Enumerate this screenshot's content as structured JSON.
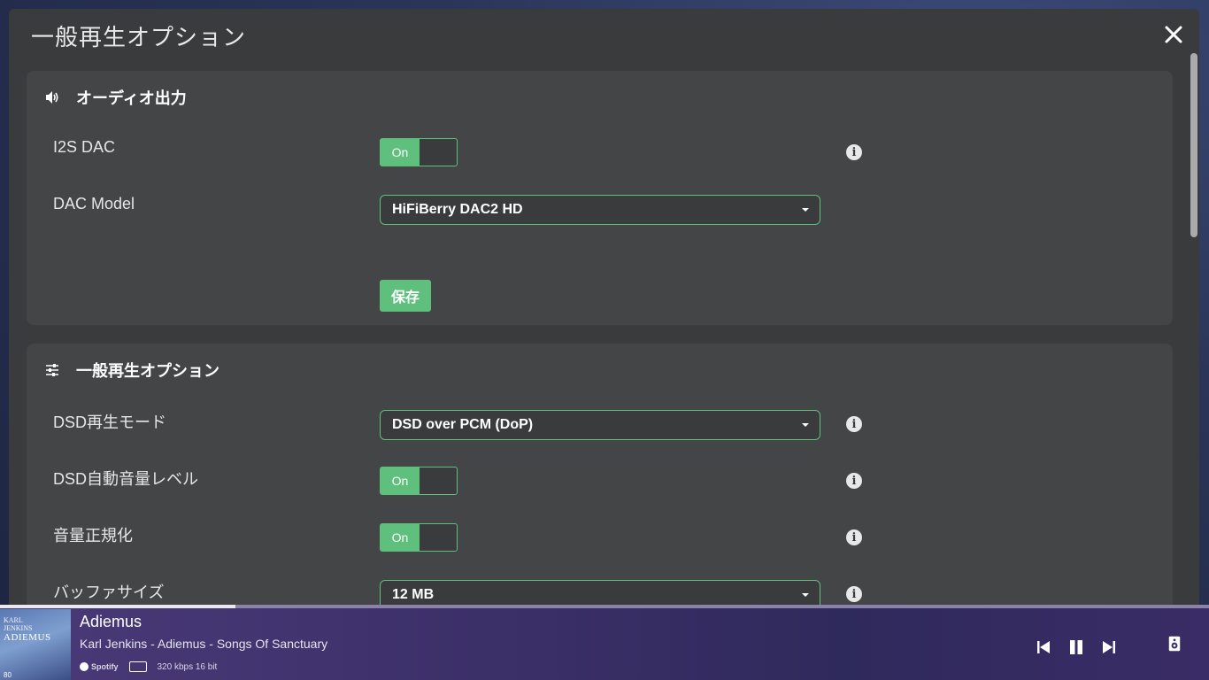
{
  "modal": {
    "title": "一般再生オプション"
  },
  "audio_output": {
    "heading": "オーディオ出力",
    "i2s_dac_label": "I2S DAC",
    "i2s_dac_toggle": "On",
    "dac_model_label": "DAC Model",
    "dac_model_value": "HiFiBerry DAC2 HD",
    "save_label": "保存"
  },
  "general_playback": {
    "heading": "一般再生オプション",
    "dsd_mode_label": "DSD再生モード",
    "dsd_mode_value": "DSD over PCM (DoP)",
    "dsd_auto_volume_label": "DSD自動音量レベル",
    "dsd_auto_volume_toggle": "On",
    "volume_normalize_label": "音量正規化",
    "volume_normalize_toggle": "On",
    "buffer_size_label": "バッファサイズ",
    "buffer_size_value": "12 MB"
  },
  "player": {
    "progress_fraction": 0.195,
    "cover_line1": "KARL\nJENKINS",
    "cover_line2": "ADIEMUS",
    "cover_badge": "80",
    "title": "Adiemus",
    "subtitle": "Karl Jenkins - Adiemus - Songs Of Sanctuary",
    "service": "Spotify",
    "quality": "320 kbps 16 bit"
  },
  "icons": {
    "close": "close-icon",
    "speaker": "volume-icon",
    "sliders": "sliders-icon",
    "info": "info-icon",
    "prev": "skip-previous-icon",
    "pause": "pause-icon",
    "next": "skip-next-icon",
    "output": "speaker-device-icon"
  },
  "colors": {
    "accent": "#5fbf7d",
    "panel": "#444546",
    "modal": "#3a3b3d"
  }
}
